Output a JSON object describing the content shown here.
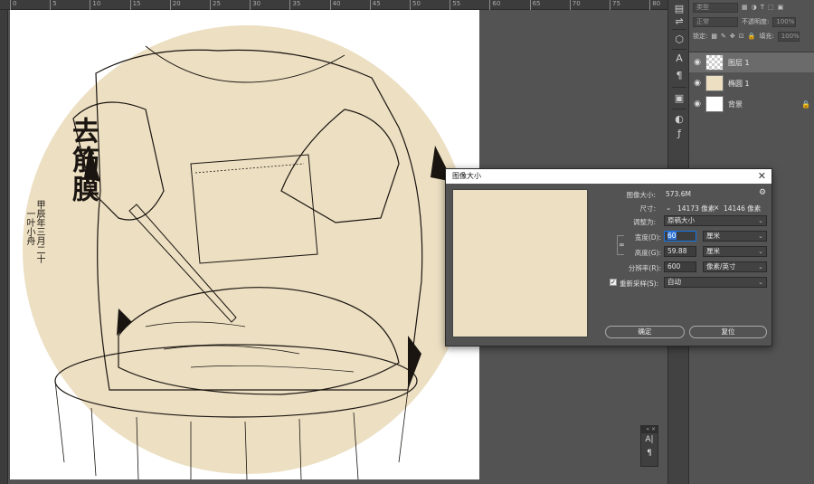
{
  "ruler": {
    "ticks": [
      "0",
      "5",
      "10",
      "15",
      "20",
      "25",
      "30",
      "35",
      "40",
      "45",
      "50",
      "55",
      "60",
      "65",
      "70",
      "75",
      "80"
    ]
  },
  "artwork": {
    "title": "去筋膜",
    "date_line": "甲辰年三月二十",
    "author_line": "一叶小舟",
    "circle_color": "#ecdfc2",
    "ink_color": "#1a1510"
  },
  "side_tools": [
    "layers-icon",
    "adjust-icon",
    "3d-icon",
    "type-icon",
    "paragraph-icon",
    "char-icon",
    "image-icon",
    "channels-icon",
    "fx-icon"
  ],
  "layers_panel": {
    "filter_placeholder": "类型",
    "blend_mode": "正常",
    "opacity_label": "不透明度:",
    "opacity_value": "100%",
    "lock_label": "锁定:",
    "fill_label": "填充:",
    "fill_value": "100%",
    "layers": [
      {
        "name": "图层 1",
        "selected": true,
        "locked": false
      },
      {
        "name": "椭圆 1",
        "selected": false,
        "locked": false
      },
      {
        "name": "背景",
        "selected": false,
        "locked": true
      }
    ]
  },
  "dialog": {
    "title": "图像大小",
    "image_size_label": "图像大小:",
    "image_size_value": "573.6M",
    "dimensions_label": "尺寸:",
    "dim_width": "14173 像素",
    "dim_times": "×",
    "dim_height": "14146 像素",
    "fit_to_label": "调整为:",
    "fit_to_value": "原稿大小",
    "width_label": "宽度(D):",
    "width_value": "60",
    "width_unit": "厘米",
    "height_label": "高度(G):",
    "height_value": "59.88",
    "height_unit": "厘米",
    "resolution_label": "分辨率(R):",
    "resolution_value": "600",
    "resolution_unit": "像素/英寸",
    "resample_label": "重新采样(S):",
    "resample_value": "自动",
    "ok_label": "确定",
    "reset_label": "复位",
    "close_glyph": "✕",
    "check_glyph": "✓"
  },
  "char_panel": {
    "header": "« ×",
    "icons": [
      "A|",
      "¶"
    ]
  }
}
